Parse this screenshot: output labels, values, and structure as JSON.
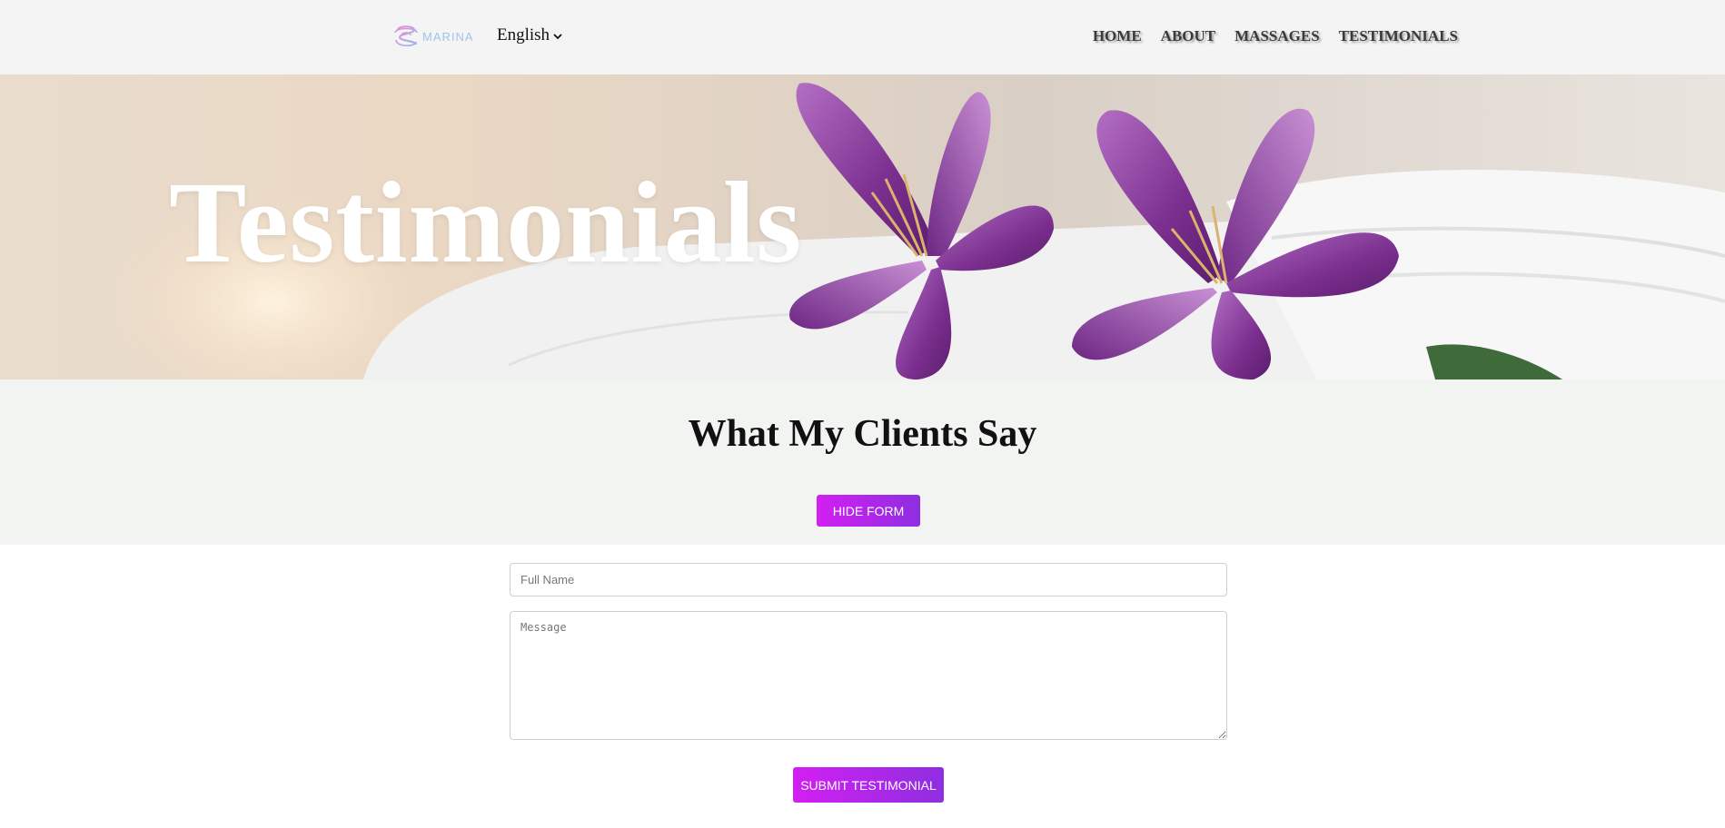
{
  "header": {
    "logo_text": "MARINA",
    "language": "English",
    "nav": [
      {
        "label": "HOME"
      },
      {
        "label": "ABOUT"
      },
      {
        "label": "MASSAGES"
      },
      {
        "label": "TESTIMONIALS"
      }
    ]
  },
  "hero": {
    "title": "Testimonials"
  },
  "section": {
    "title": "What My Clients Say",
    "hide_form_label": "HIDE FORM"
  },
  "form": {
    "name_placeholder": "Full Name",
    "message_placeholder": "Message",
    "submit_label": "SUBMIT TESTIMONIAL"
  },
  "colors": {
    "accent_start": "#d31ff2",
    "accent_end": "#8e2ee0",
    "header_bg": "#f4f4f4",
    "section_bg": "#f2f4f2"
  },
  "icons": {
    "logo": "logo-swirl-icon",
    "language_dropdown": "chevron-down-icon"
  }
}
